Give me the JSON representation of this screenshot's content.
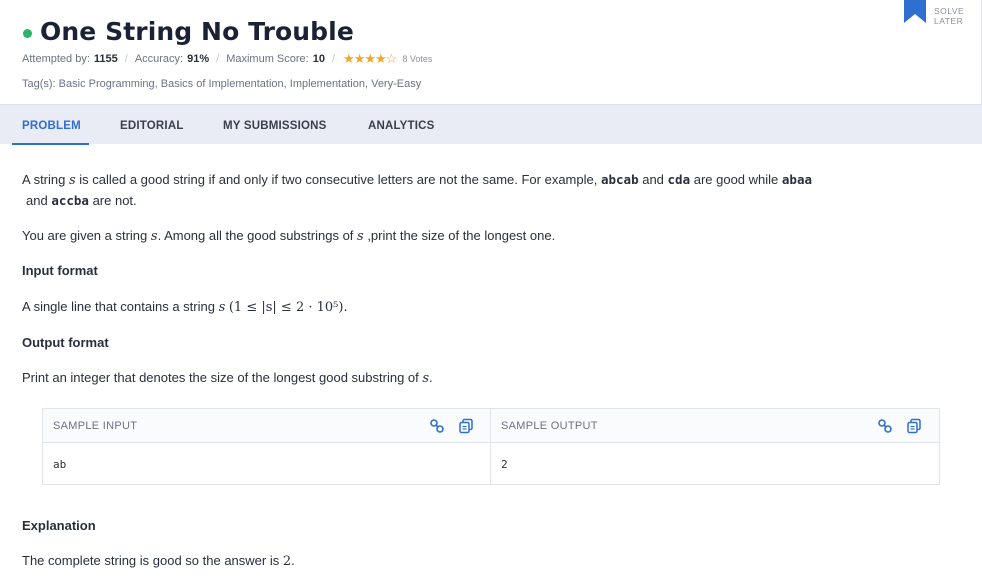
{
  "problem": {
    "title": "One String No Trouble",
    "status_color": "#2ab56a",
    "attempted_label": "Attempted by:",
    "attempted_value": "1155",
    "accuracy_label": "Accuracy:",
    "accuracy_value": "91%",
    "max_score_label": "Maximum Score:",
    "max_score_value": "10",
    "rating_stars": 4,
    "rating_max": 5,
    "stars_text": "★★★★☆",
    "votes": "8 Votes",
    "tags": "Tag(s): Basic Programming, Basics of Implementation, Implementation, Very-Easy"
  },
  "solve_later": {
    "line1": "SOLVE",
    "line2": "LATER",
    "icon": "bookmark-icon",
    "color": "#2f6fd1"
  },
  "tabs": [
    {
      "label": "PROBLEM",
      "active": true
    },
    {
      "label": "EDITORIAL",
      "active": false
    },
    {
      "label": "MY SUBMISSIONS",
      "active": false
    },
    {
      "label": "ANALYTICS",
      "active": false
    }
  ],
  "statement": {
    "p1_a": "A string ",
    "p1_var": "s",
    "p1_b": " is called a good string if and only if two consecutive letters are not the same. For example, ",
    "ex1": "abcab",
    "p1_c": " and  ",
    "ex2": "cda",
    "p1_d": " are good while ",
    "ex3": "abaa",
    "p1_e": "and ",
    "ex4": "accba",
    "p1_f": " are not.",
    "p2_a": "You are given a string ",
    "p2_var": "s",
    "p2_b": ". Among all the good substrings of ",
    "p2_var2": "s",
    "p2_c": " ,print the size of the longest one.",
    "input_heading": "Input format",
    "input_a": "A single line that contains a string ",
    "input_var": "s",
    "input_constraint": "(1 ≤ |s| ≤ 2 · 10⁵).",
    "output_heading": "Output format",
    "output_a": "Print an integer that denotes the size of the longest good substring of ",
    "output_var": "s",
    "output_b": ".",
    "explanation_heading": "Explanation",
    "explanation_a": "The complete string is good so the answer is ",
    "explanation_val": "2",
    "explanation_b": "."
  },
  "sample": {
    "input_title": "SAMPLE INPUT",
    "input_value": "ab",
    "output_title": "SAMPLE OUTPUT",
    "output_value": "2",
    "link_icon": "link-icon",
    "copy_icon": "copy-icon",
    "icon_color": "#2f6fd1"
  }
}
